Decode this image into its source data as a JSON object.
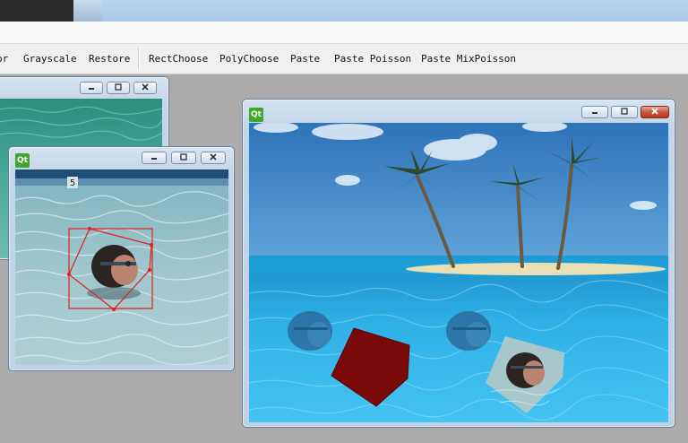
{
  "toolbar": {
    "items": [
      "or",
      "Grayscale",
      "Restore",
      "RectChoose",
      "PolyChoose",
      "Paste",
      "Paste Poisson",
      "Paste MixPoisson"
    ]
  },
  "windows": {
    "source_window": {
      "icon": "Qt"
    },
    "target_window": {
      "icon": "Qt"
    },
    "background_window": {
      "icon": "Qt"
    }
  },
  "images": {
    "source": {
      "lane_marker": "5",
      "description_icon": "swimmer-photo"
    },
    "target": {
      "description_icon": "tropical-beach-photo"
    }
  },
  "colors": {
    "selection_outline": "#e02020",
    "pasted_polygon_fill": "#7a0a0a",
    "window_frame": "#c3d5e8",
    "close_button": "#c8513b"
  }
}
